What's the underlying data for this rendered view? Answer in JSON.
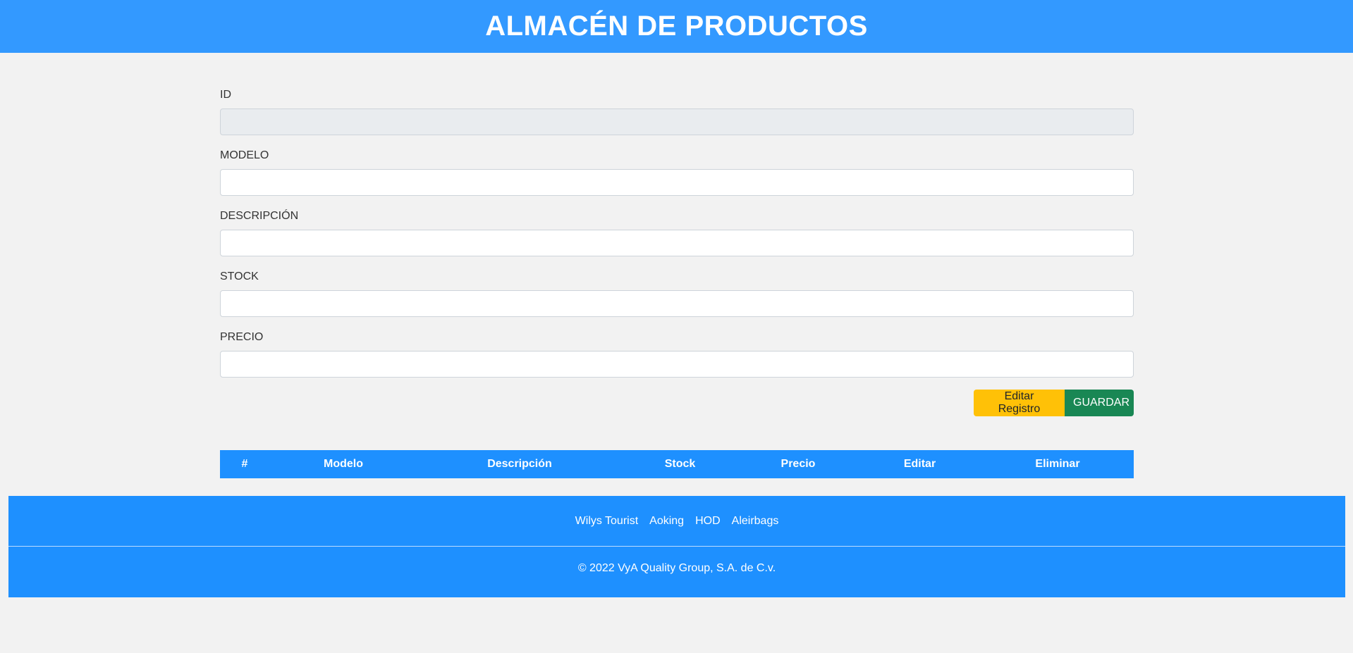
{
  "header": {
    "title": "ALMACÉN DE PRODUCTOS"
  },
  "form": {
    "fields": [
      {
        "label": "ID",
        "value": "",
        "disabled": true
      },
      {
        "label": "MODELO",
        "value": ""
      },
      {
        "label": "DESCRIPCIÓN",
        "value": ""
      },
      {
        "label": "STOCK",
        "value": ""
      },
      {
        "label": "PRECIO",
        "value": ""
      }
    ],
    "edit_button": "Editar Registro",
    "save_button": "GUARDAR"
  },
  "table": {
    "columns": [
      "#",
      "Modelo",
      "Descripción",
      "Stock",
      "Precio",
      "Editar",
      "Eliminar"
    ],
    "rows": []
  },
  "footer": {
    "links": [
      "Wilys Tourist",
      "Aoking",
      "HOD",
      "Aleirbags"
    ],
    "copyright": "© 2022 VyA Quality Group, S.A. de C.v."
  },
  "colors": {
    "header_bg": "#3399ff",
    "table_head_bg": "#1e90ff",
    "footer_bg": "#1e90ff",
    "edit_button": "#ffc107",
    "save_button": "#198754"
  }
}
